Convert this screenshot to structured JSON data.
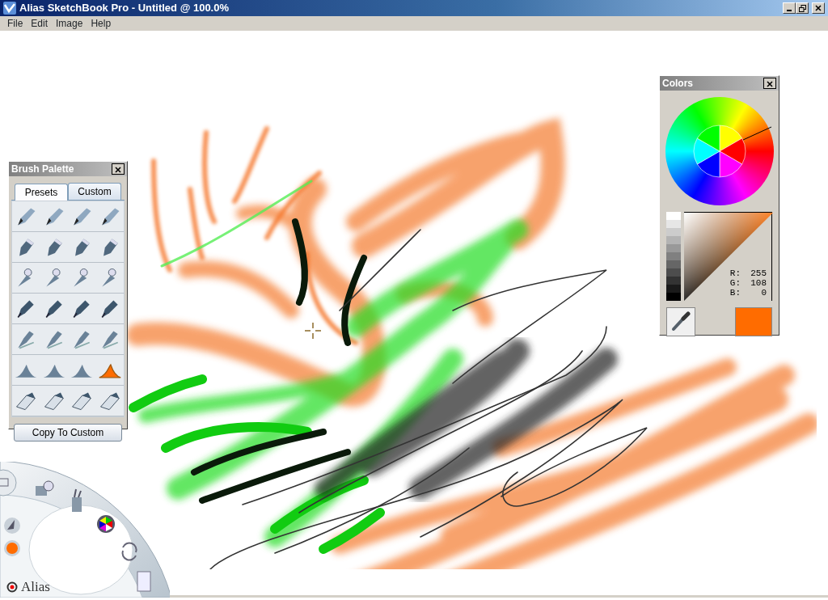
{
  "window": {
    "title": "Alias SketchBook Pro - Untitled @ 100.0%"
  },
  "menu": [
    "File",
    "Edit",
    "Image",
    "Help"
  ],
  "brush_palette": {
    "title": "Brush Palette",
    "tabs": [
      {
        "label": "Presets",
        "selected": true
      },
      {
        "label": "Custom",
        "selected": false
      }
    ],
    "brushes": [
      {
        "kind": "pencil",
        "selected": false
      },
      {
        "kind": "pencil",
        "selected": false
      },
      {
        "kind": "pencil",
        "selected": false
      },
      {
        "kind": "pencil",
        "selected": false
      },
      {
        "kind": "marker",
        "selected": false
      },
      {
        "kind": "marker",
        "selected": false
      },
      {
        "kind": "marker",
        "selected": false
      },
      {
        "kind": "marker",
        "selected": false
      },
      {
        "kind": "airbrush",
        "selected": false
      },
      {
        "kind": "airbrush",
        "selected": false
      },
      {
        "kind": "airbrush",
        "selected": false
      },
      {
        "kind": "airbrush",
        "selected": false
      },
      {
        "kind": "pen",
        "selected": false
      },
      {
        "kind": "pen",
        "selected": false
      },
      {
        "kind": "pen",
        "selected": false
      },
      {
        "kind": "pen",
        "selected": false
      },
      {
        "kind": "brush",
        "selected": false
      },
      {
        "kind": "brush",
        "selected": false
      },
      {
        "kind": "brush",
        "selected": false
      },
      {
        "kind": "brush",
        "selected": false
      },
      {
        "kind": "smudge",
        "selected": false
      },
      {
        "kind": "smudge",
        "selected": false
      },
      {
        "kind": "smudge",
        "selected": false
      },
      {
        "kind": "smudge",
        "selected": true
      },
      {
        "kind": "eraser",
        "selected": false
      },
      {
        "kind": "eraser",
        "selected": false
      },
      {
        "kind": "eraser",
        "selected": false
      },
      {
        "kind": "eraser",
        "selected": false
      }
    ],
    "button": "Copy To Custom"
  },
  "colors": {
    "title": "Colors",
    "readouts": [
      {
        "label": "R:",
        "value": "255"
      },
      {
        "label": "G:",
        "value": "108"
      },
      {
        "label": "B:",
        "value": "0"
      }
    ]
  },
  "lagoon": {
    "logo": "Alias"
  }
}
